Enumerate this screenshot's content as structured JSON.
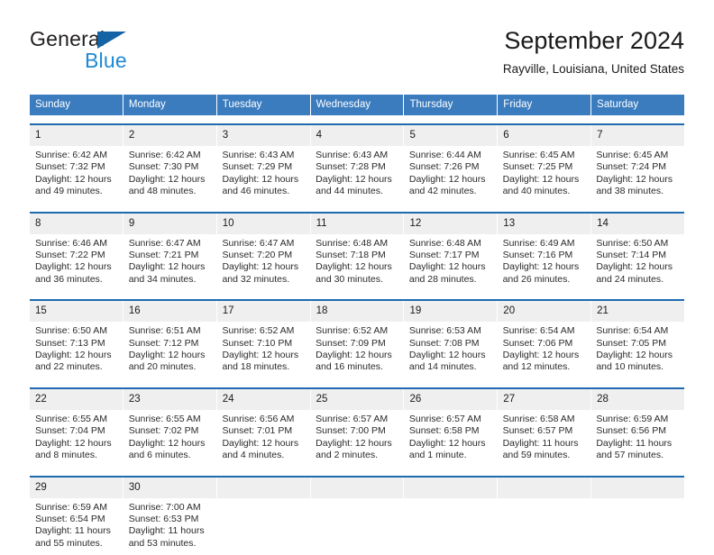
{
  "brand": {
    "name_dark": "General",
    "name_blue": "Blue",
    "accent_blue": "#1f8ad4",
    "logo_triangle_color": "#1464a5"
  },
  "header": {
    "title": "September 2024",
    "subtitle": "Rayville, Louisiana, United States"
  },
  "theme": {
    "header_band": "#3b7cbf",
    "row_rule": "#1f6ab0",
    "day_band": "#efefef"
  },
  "weekdays": [
    "Sunday",
    "Monday",
    "Tuesday",
    "Wednesday",
    "Thursday",
    "Friday",
    "Saturday"
  ],
  "weeks": [
    {
      "days": [
        {
          "date": "1",
          "sunrise": "Sunrise: 6:42 AM",
          "sunset": "Sunset: 7:32 PM",
          "daylight": "Daylight: 12 hours and 49 minutes."
        },
        {
          "date": "2",
          "sunrise": "Sunrise: 6:42 AM",
          "sunset": "Sunset: 7:30 PM",
          "daylight": "Daylight: 12 hours and 48 minutes."
        },
        {
          "date": "3",
          "sunrise": "Sunrise: 6:43 AM",
          "sunset": "Sunset: 7:29 PM",
          "daylight": "Daylight: 12 hours and 46 minutes."
        },
        {
          "date": "4",
          "sunrise": "Sunrise: 6:43 AM",
          "sunset": "Sunset: 7:28 PM",
          "daylight": "Daylight: 12 hours and 44 minutes."
        },
        {
          "date": "5",
          "sunrise": "Sunrise: 6:44 AM",
          "sunset": "Sunset: 7:26 PM",
          "daylight": "Daylight: 12 hours and 42 minutes."
        },
        {
          "date": "6",
          "sunrise": "Sunrise: 6:45 AM",
          "sunset": "Sunset: 7:25 PM",
          "daylight": "Daylight: 12 hours and 40 minutes."
        },
        {
          "date": "7",
          "sunrise": "Sunrise: 6:45 AM",
          "sunset": "Sunset: 7:24 PM",
          "daylight": "Daylight: 12 hours and 38 minutes."
        }
      ]
    },
    {
      "days": [
        {
          "date": "8",
          "sunrise": "Sunrise: 6:46 AM",
          "sunset": "Sunset: 7:22 PM",
          "daylight": "Daylight: 12 hours and 36 minutes."
        },
        {
          "date": "9",
          "sunrise": "Sunrise: 6:47 AM",
          "sunset": "Sunset: 7:21 PM",
          "daylight": "Daylight: 12 hours and 34 minutes."
        },
        {
          "date": "10",
          "sunrise": "Sunrise: 6:47 AM",
          "sunset": "Sunset: 7:20 PM",
          "daylight": "Daylight: 12 hours and 32 minutes."
        },
        {
          "date": "11",
          "sunrise": "Sunrise: 6:48 AM",
          "sunset": "Sunset: 7:18 PM",
          "daylight": "Daylight: 12 hours and 30 minutes."
        },
        {
          "date": "12",
          "sunrise": "Sunrise: 6:48 AM",
          "sunset": "Sunset: 7:17 PM",
          "daylight": "Daylight: 12 hours and 28 minutes."
        },
        {
          "date": "13",
          "sunrise": "Sunrise: 6:49 AM",
          "sunset": "Sunset: 7:16 PM",
          "daylight": "Daylight: 12 hours and 26 minutes."
        },
        {
          "date": "14",
          "sunrise": "Sunrise: 6:50 AM",
          "sunset": "Sunset: 7:14 PM",
          "daylight": "Daylight: 12 hours and 24 minutes."
        }
      ]
    },
    {
      "days": [
        {
          "date": "15",
          "sunrise": "Sunrise: 6:50 AM",
          "sunset": "Sunset: 7:13 PM",
          "daylight": "Daylight: 12 hours and 22 minutes."
        },
        {
          "date": "16",
          "sunrise": "Sunrise: 6:51 AM",
          "sunset": "Sunset: 7:12 PM",
          "daylight": "Daylight: 12 hours and 20 minutes."
        },
        {
          "date": "17",
          "sunrise": "Sunrise: 6:52 AM",
          "sunset": "Sunset: 7:10 PM",
          "daylight": "Daylight: 12 hours and 18 minutes."
        },
        {
          "date": "18",
          "sunrise": "Sunrise: 6:52 AM",
          "sunset": "Sunset: 7:09 PM",
          "daylight": "Daylight: 12 hours and 16 minutes."
        },
        {
          "date": "19",
          "sunrise": "Sunrise: 6:53 AM",
          "sunset": "Sunset: 7:08 PM",
          "daylight": "Daylight: 12 hours and 14 minutes."
        },
        {
          "date": "20",
          "sunrise": "Sunrise: 6:54 AM",
          "sunset": "Sunset: 7:06 PM",
          "daylight": "Daylight: 12 hours and 12 minutes."
        },
        {
          "date": "21",
          "sunrise": "Sunrise: 6:54 AM",
          "sunset": "Sunset: 7:05 PM",
          "daylight": "Daylight: 12 hours and 10 minutes."
        }
      ]
    },
    {
      "days": [
        {
          "date": "22",
          "sunrise": "Sunrise: 6:55 AM",
          "sunset": "Sunset: 7:04 PM",
          "daylight": "Daylight: 12 hours and 8 minutes."
        },
        {
          "date": "23",
          "sunrise": "Sunrise: 6:55 AM",
          "sunset": "Sunset: 7:02 PM",
          "daylight": "Daylight: 12 hours and 6 minutes."
        },
        {
          "date": "24",
          "sunrise": "Sunrise: 6:56 AM",
          "sunset": "Sunset: 7:01 PM",
          "daylight": "Daylight: 12 hours and 4 minutes."
        },
        {
          "date": "25",
          "sunrise": "Sunrise: 6:57 AM",
          "sunset": "Sunset: 7:00 PM",
          "daylight": "Daylight: 12 hours and 2 minutes."
        },
        {
          "date": "26",
          "sunrise": "Sunrise: 6:57 AM",
          "sunset": "Sunset: 6:58 PM",
          "daylight": "Daylight: 12 hours and 1 minute."
        },
        {
          "date": "27",
          "sunrise": "Sunrise: 6:58 AM",
          "sunset": "Sunset: 6:57 PM",
          "daylight": "Daylight: 11 hours and 59 minutes."
        },
        {
          "date": "28",
          "sunrise": "Sunrise: 6:59 AM",
          "sunset": "Sunset: 6:56 PM",
          "daylight": "Daylight: 11 hours and 57 minutes."
        }
      ]
    },
    {
      "days": [
        {
          "date": "29",
          "sunrise": "Sunrise: 6:59 AM",
          "sunset": "Sunset: 6:54 PM",
          "daylight": "Daylight: 11 hours and 55 minutes."
        },
        {
          "date": "30",
          "sunrise": "Sunrise: 7:00 AM",
          "sunset": "Sunset: 6:53 PM",
          "daylight": "Daylight: 11 hours and 53 minutes."
        },
        {
          "date": "",
          "sunrise": "",
          "sunset": "",
          "daylight": ""
        },
        {
          "date": "",
          "sunrise": "",
          "sunset": "",
          "daylight": ""
        },
        {
          "date": "",
          "sunrise": "",
          "sunset": "",
          "daylight": ""
        },
        {
          "date": "",
          "sunrise": "",
          "sunset": "",
          "daylight": ""
        },
        {
          "date": "",
          "sunrise": "",
          "sunset": "",
          "daylight": ""
        }
      ]
    }
  ]
}
